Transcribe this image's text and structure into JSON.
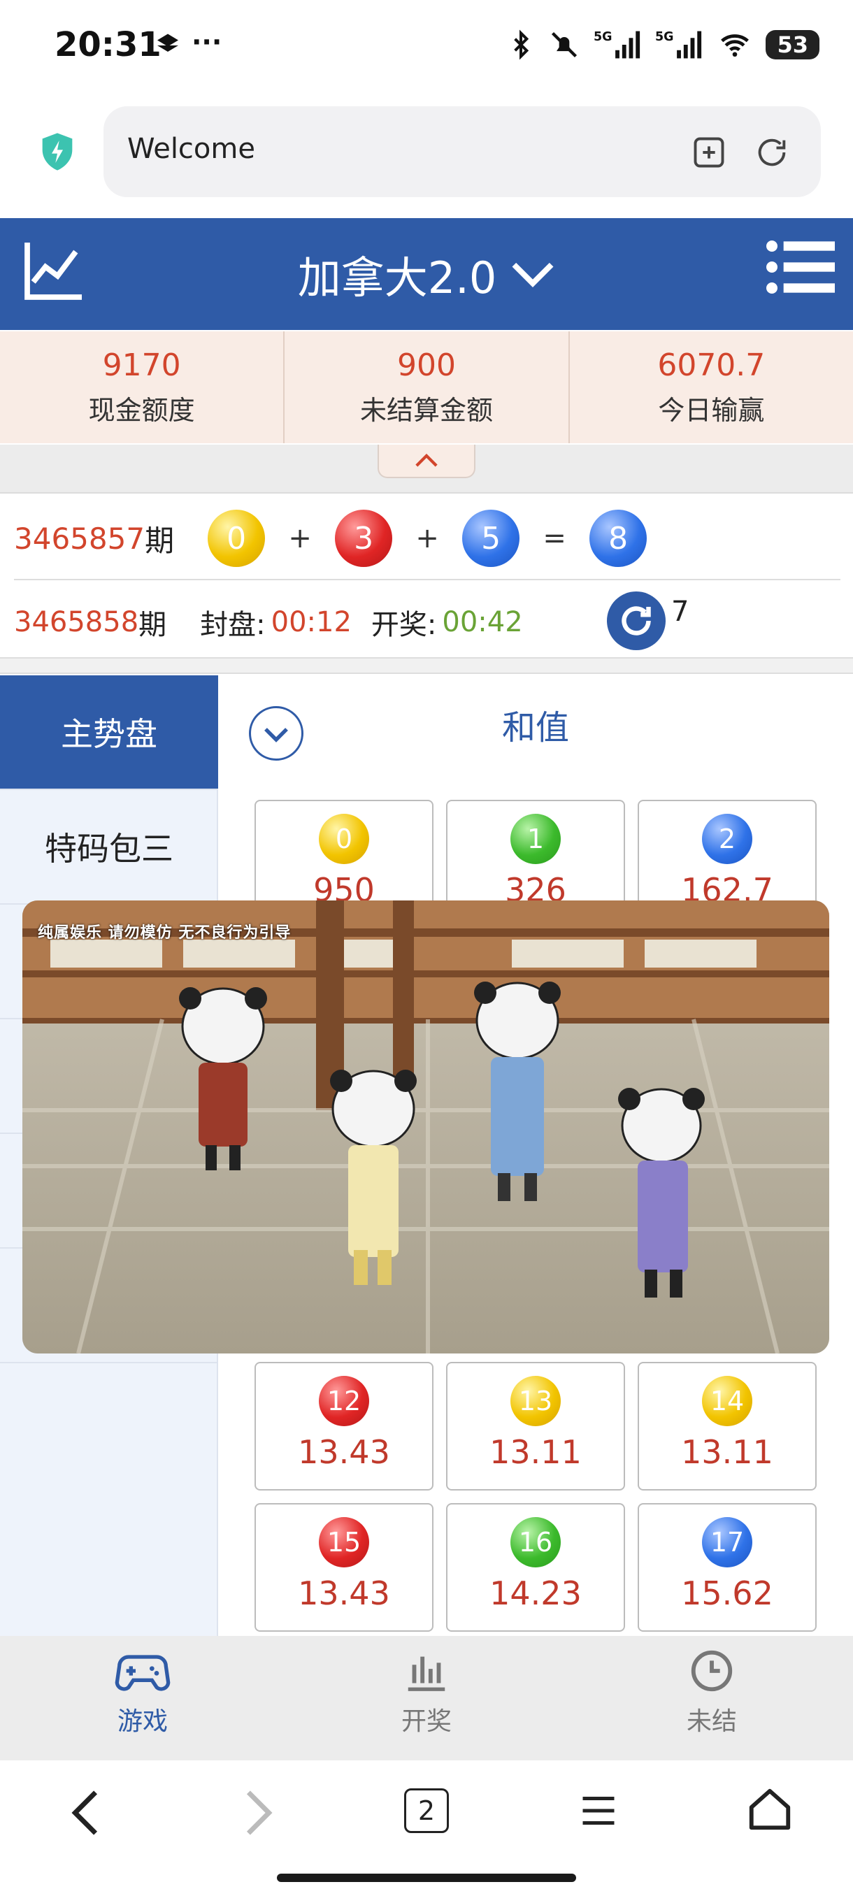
{
  "status_bar": {
    "time": "20:31",
    "battery": "53",
    "network": "5G"
  },
  "browser": {
    "url_text": "Welcome",
    "tabs_count": "2"
  },
  "header": {
    "title": "加拿大2.0"
  },
  "summary": [
    {
      "value": "9170",
      "label": "现金额度"
    },
    {
      "value": "900",
      "label": "未结算金额"
    },
    {
      "value": "6070.7",
      "label": "今日输赢"
    }
  ],
  "last_draw": {
    "period_number": "3465857",
    "period_suffix": "期",
    "balls": [
      {
        "n": "0",
        "color": "yellow"
      },
      {
        "n": "3",
        "color": "red"
      },
      {
        "n": "5",
        "color": "blue"
      }
    ],
    "plus": "+",
    "equals": "=",
    "sum": "8",
    "sum_color": "blue"
  },
  "next_draw": {
    "period_number": "3465858",
    "period_suffix": "期",
    "close_label": "封盘:",
    "close_time": "00:12",
    "open_label": "开奖:",
    "open_time": "00:42",
    "refresh_count": "7"
  },
  "left_nav": [
    {
      "label": "主势盘",
      "active": true
    },
    {
      "label": "特码包三",
      "active": false
    }
  ],
  "section_title": "和值",
  "odds_grid": [
    {
      "n": "0",
      "color": "yellow",
      "odds": "950"
    },
    {
      "n": "1",
      "color": "green",
      "odds": "326"
    },
    {
      "n": "2",
      "color": "blue",
      "odds": "162.7"
    },
    {
      "n": "12",
      "color": "red",
      "odds": "13.43"
    },
    {
      "n": "13",
      "color": "yellow",
      "odds": "13.11"
    },
    {
      "n": "14",
      "color": "yellow",
      "odds": "13.11"
    },
    {
      "n": "15",
      "color": "red",
      "odds": "13.43"
    },
    {
      "n": "16",
      "color": "green",
      "odds": "14.23"
    },
    {
      "n": "17",
      "color": "blue",
      "odds": "15.62"
    }
  ],
  "video": {
    "watermark": "纯属娱乐 请勿模仿 无不良行为引导"
  },
  "bottom_tabs": [
    {
      "label": "游戏",
      "icon": "gamepad-icon",
      "active": true
    },
    {
      "label": "开奖",
      "icon": "bar-chart-icon",
      "active": false
    },
    {
      "label": "未结",
      "icon": "clock-icon",
      "active": false
    }
  ],
  "colors": {
    "primary": "#2f5ba7",
    "accent_red": "#d2452c",
    "green_time": "#6aa336",
    "summary_bg": "#f9ece5"
  }
}
